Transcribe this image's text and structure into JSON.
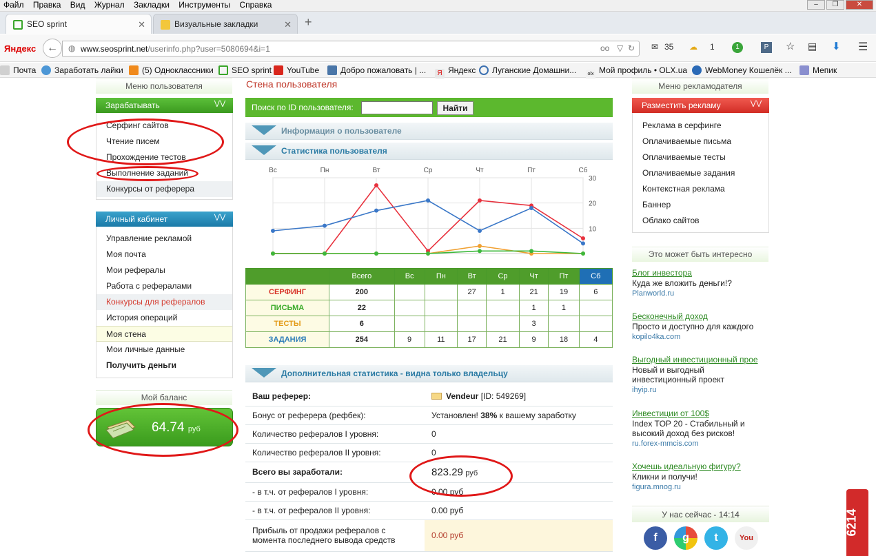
{
  "menubar": [
    "Файл",
    "Правка",
    "Вид",
    "Журнал",
    "Закладки",
    "Инструменты",
    "Справка"
  ],
  "tabs": [
    {
      "label": "SEO sprint"
    },
    {
      "label": "Визуальные закладки"
    }
  ],
  "yandex_logo": "Яндекс",
  "url": {
    "host": "www.seosprint.net",
    "path": "/userinfo.php?user=5080694&i=1"
  },
  "toolbar": {
    "mail_count": "35",
    "weather": "1",
    "badge": "1"
  },
  "bookmarks": [
    "Почта",
    "Заработать лайки",
    "(5) Одноклассники",
    "SEO sprint",
    "YouTube",
    "Добро пожаловать | ...",
    "Яндекс",
    "Луганские Домашни...",
    "Мой профиль • OLX.ua",
    "WebMoney Кошелёк ...",
    "Мепик"
  ],
  "left": {
    "user_menu_title": "Меню пользователя",
    "earn": {
      "title": "Зарабатывать",
      "items": [
        "Серфинг сайтов",
        "Чтение писем",
        "Прохождение тестов",
        "Выполнение заданий",
        "Конкурсы от реферера"
      ]
    },
    "cabinet": {
      "title": "Личный кабинет",
      "items": [
        "Управление рекламой",
        "Моя почта",
        "Мои рефералы",
        "Работа с рефералами",
        "Конкурсы для рефералов",
        "История операций",
        "Моя стена",
        "Мои личные данные",
        "Получить деньги"
      ]
    },
    "balance_title": "Мой баланс",
    "balance": "64.74",
    "balance_cur": "руб"
  },
  "center": {
    "title": "Стена пользователя",
    "search_label": "Поиск по ID пользователя:",
    "search_value": "",
    "search_button": "Найти",
    "info_title": "Информация о пользователе",
    "stats_title": "Статистика пользователя",
    "add_title": "Дополнительная статистика - видна только владельцу"
  },
  "chart_data": {
    "type": "line",
    "categories": [
      "Вс",
      "Пн",
      "Вт",
      "Ср",
      "Чт",
      "Пт",
      "Сб"
    ],
    "ylim": [
      0,
      30
    ],
    "yticks": [
      "30",
      "20",
      "10"
    ],
    "series": [
      {
        "key": "surfing",
        "color": "#e8323e",
        "values": [
          0,
          0,
          27,
          1,
          21,
          19,
          6
        ]
      },
      {
        "key": "tests",
        "color": "#f0a030",
        "values": [
          0,
          0,
          0,
          0,
          3,
          0,
          0
        ]
      },
      {
        "key": "letters",
        "color": "#3cb83c",
        "values": [
          0,
          0,
          0,
          0,
          1,
          1,
          0
        ]
      },
      {
        "key": "tasks",
        "color": "#3b78c8",
        "values": [
          9,
          11,
          17,
          21,
          9,
          18,
          4
        ]
      }
    ]
  },
  "table": {
    "headers": [
      "Всего",
      "Вс",
      "Пн",
      "Вт",
      "Ср",
      "Чт",
      "Пт",
      "Сб"
    ],
    "rows": [
      {
        "label": "СЕРФИНГ",
        "color": "#d8352a",
        "cells": [
          "200",
          "",
          "",
          "27",
          "1",
          "21",
          "19",
          "6"
        ]
      },
      {
        "label": "ПИСЬМА",
        "color": "#3aab2a",
        "cells": [
          "22",
          "",
          "",
          "",
          "",
          "1",
          "1",
          ""
        ]
      },
      {
        "label": "ТЕСТЫ",
        "color": "#e39a17",
        "cells": [
          "6",
          "",
          "",
          "",
          "",
          "3",
          "",
          ""
        ]
      },
      {
        "label": "ЗАДАНИЯ",
        "color": "#2d7db8",
        "cells": [
          "254",
          "9",
          "11",
          "17",
          "21",
          "9",
          "18",
          "4"
        ]
      }
    ]
  },
  "additional": {
    "referrer_label": "Ваш реферер:",
    "referrer_name": "Vendeur",
    "referrer_id": "[ID: 549269]",
    "bonus_label": "Бонус от реферера (рефбек):",
    "bonus_pre": "Установлен!",
    "bonus_pct": "38%",
    "bonus_post": "к вашему заработку",
    "ref1_label": "Количество рефералов I уровня:",
    "ref1_value": "0",
    "ref2_label": "Количество рефералов II уровня:",
    "ref2_value": "0",
    "total_label": "Всего вы заработали:",
    "total_value": "823.29",
    "total_cur": "руб",
    "from1_label": "- в т.ч. от рефералов I уровня:",
    "from1_value": "0.00 руб",
    "from2_label": "- в т.ч. от рефералов II уровня:",
    "from2_value": "0.00 руб",
    "sale_label": "Прибыль от продажи рефералов с момента последнего вывода средств",
    "sale_value": "0.00 руб"
  },
  "right": {
    "ad_menu_title": "Меню рекламодателя",
    "place_ad": "Разместить рекламу",
    "items": [
      "Реклама в серфинге",
      "Оплачиваемые письма",
      "Оплачиваемые тесты",
      "Оплачиваемые задания",
      "Контекстная реклама",
      "Баннер",
      "Облако сайтов"
    ],
    "interesting_title": "Это может быть интересно",
    "links": [
      {
        "title": "Блог инвестора",
        "desc": "Куда же вложить деньги!?",
        "site": "Planworld.ru"
      },
      {
        "title": "Бесконечный доход",
        "desc": "Просто и доступно для каждого",
        "site": "kopilo4ka.com"
      },
      {
        "title": "Выгодный инвестиционный прое",
        "desc": "Новый и выгодный инвестиционный проект",
        "site": "ihyip.ru"
      },
      {
        "title": "Инвестиции от 100$",
        "desc": "Index TOP 20 - Стабильный и высокий доход без рисков!",
        "site": "ru.forex-mmcis.com"
      },
      {
        "title": "Хочешь идеальную фигуру?",
        "desc": "Кликни и получи!",
        "site": "figura.mnog.ru"
      }
    ],
    "now_label": "У нас сейчас - 14:14",
    "social": [
      "f",
      "g",
      "t",
      "You"
    ],
    "counter": "6214"
  }
}
